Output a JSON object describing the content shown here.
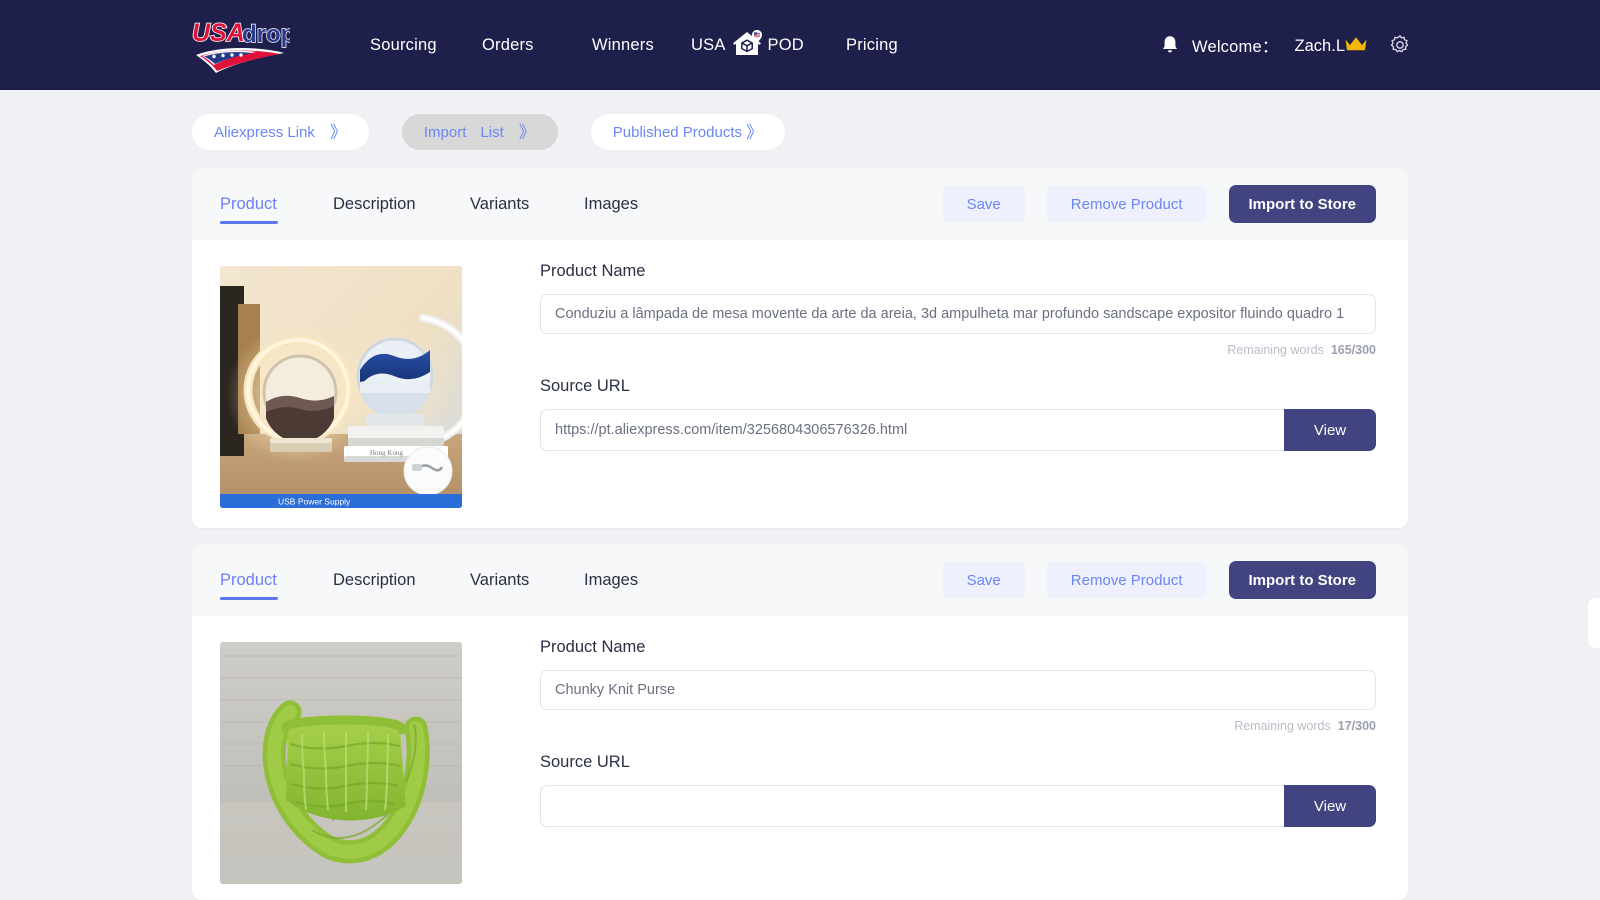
{
  "header": {
    "logo_alt": "USAdrop",
    "nav": [
      {
        "label": "Sourcing",
        "icon": null
      },
      {
        "label": "Orders",
        "icon": null
      },
      {
        "label": "Winners",
        "icon": null
      },
      {
        "label": "USA",
        "label2": "POD",
        "icon": "usa-pod-warehouse-icon"
      },
      {
        "label": "Pricing",
        "icon": null
      }
    ],
    "notification_icon": "bell-icon",
    "welcome_label": "Welcome：",
    "user_name": "Zach.L",
    "user_badge_icon": "crown-icon",
    "settings_icon": "gear-icon"
  },
  "breadcrumb_pills": [
    {
      "label": "Aliexpress Link",
      "label2": "",
      "chevron": "》",
      "active": false
    },
    {
      "label": "Import",
      "label2": "List",
      "chevron": "》",
      "active": true
    },
    {
      "label": "Published Products",
      "label2": "",
      "chevron": "》",
      "active": false
    }
  ],
  "tabs": [
    {
      "label": "Product",
      "active": true
    },
    {
      "label": "Description",
      "active": false
    },
    {
      "label": "Variants",
      "active": false
    },
    {
      "label": "Images",
      "active": false
    }
  ],
  "actions": {
    "save_label": "Save",
    "remove_label": "Remove Product",
    "import_label": "Import to Store",
    "view_label": "View"
  },
  "labels": {
    "product_name": "Product Name",
    "source_url": "Source URL",
    "remaining_words": "Remaining words"
  },
  "products": [
    {
      "image_name": "sand-art-lamp-photo",
      "image_badge": "USB Power Supply",
      "product_name": "Conduziu a lâmpada de mesa movente da arte da areia, 3d ampulheta mar profundo sandscape expositor fluindo quadro 1",
      "word_count": "165/300",
      "source_url": "https://pt.aliexpress.com/item/3256804306576326.html",
      "source_url_placeholder": ""
    },
    {
      "image_name": "chunky-knit-purse-photo",
      "image_badge": "",
      "product_name": "Chunky Knit Purse",
      "word_count": "17/300",
      "source_url": "",
      "source_url_placeholder": ""
    }
  ],
  "colors": {
    "header_bg": "#1e1f4b",
    "accent_blue": "#6b87f5",
    "primary_button": "#424481",
    "page_bg": "#f0f1f4",
    "crown_gold": "#f2b705"
  }
}
